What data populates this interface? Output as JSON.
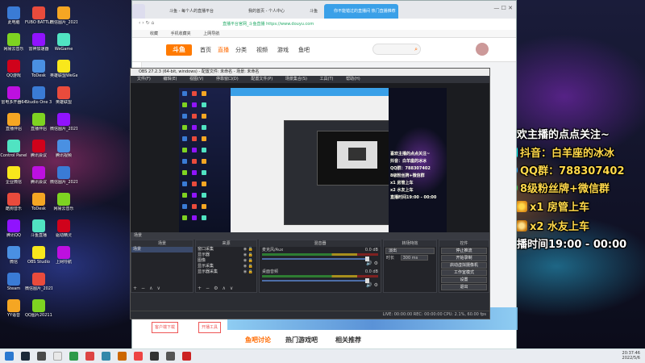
{
  "desktop_icons": [
    {
      "label": "此电脑",
      "x": 0,
      "y": 0
    },
    {
      "label": "FUBO BATTLEGR...",
      "x": 1,
      "y": 0
    },
    {
      "label": "微信图片_2021121...",
      "x": 2,
      "y": 0
    },
    {
      "label": "网易云音乐",
      "x": 0,
      "y": 1
    },
    {
      "label": "雷神加速器",
      "x": 1,
      "y": 1
    },
    {
      "label": "WeGame",
      "x": 2,
      "y": 1
    },
    {
      "label": "QQ游戏",
      "x": 0,
      "y": 2
    },
    {
      "label": "ToDesk",
      "x": 1,
      "y": 2
    },
    {
      "label": "英雄联盟WeGame版",
      "x": 2,
      "y": 2
    },
    {
      "label": "雷电多开器64",
      "x": 0,
      "y": 3
    },
    {
      "label": "Studio One 3",
      "x": 1,
      "y": 3
    },
    {
      "label": "英雄联盟",
      "x": 2,
      "y": 3
    },
    {
      "label": "直播伴侣",
      "x": 0,
      "y": 4
    },
    {
      "label": "直播伴侣",
      "x": 1,
      "y": 4
    },
    {
      "label": "微信图片_2021121...",
      "x": 2,
      "y": 4
    },
    {
      "label": "Control Panel",
      "x": 0,
      "y": 5
    },
    {
      "label": "腾讯会议",
      "x": 1,
      "y": 5
    },
    {
      "label": "腾讯视频",
      "x": 2,
      "y": 5
    },
    {
      "label": "企业微信",
      "x": 0,
      "y": 6
    },
    {
      "label": "腾讯会议",
      "x": 1,
      "y": 6
    },
    {
      "label": "微信图片_2021121...",
      "x": 2,
      "y": 6
    },
    {
      "label": "酷狗音乐",
      "x": 0,
      "y": 7
    },
    {
      "label": "ToDesk",
      "x": 1,
      "y": 7
    },
    {
      "label": "网易云音乐",
      "x": 2,
      "y": 7
    },
    {
      "label": "腾讯QQ",
      "x": 0,
      "y": 8
    },
    {
      "label": "斗鱼直播",
      "x": 1,
      "y": 8
    },
    {
      "label": "驱动精灵",
      "x": 2,
      "y": 8
    },
    {
      "label": "微信",
      "x": 0,
      "y": 9
    },
    {
      "label": "OBS Studio",
      "x": 1,
      "y": 9
    },
    {
      "label": "上网导航",
      "x": 2,
      "y": 9
    },
    {
      "label": "Steam",
      "x": 0,
      "y": 10
    },
    {
      "label": "微信图片_2021120...",
      "x": 1,
      "y": 10
    },
    {
      "label": "YY语音",
      "x": 0,
      "y": 11
    },
    {
      "label": "QQ图片2021120...",
      "x": 1,
      "y": 11
    }
  ],
  "promo": {
    "line1": "喜欢主播的点点关注~",
    "line2": "抖音：白羊座的冰冰",
    "line3": "QQ群：788307402",
    "line4": "8级粉丝牌+微信群",
    "line5": "x1 房管上车",
    "line6": "x2 水友上车",
    "line7": "直播时间19:00 - 00:00"
  },
  "browser": {
    "tabs": [
      "斗鱼 - 每个人的直播平台",
      "我的首页 - 个人中心",
      "斗鱼",
      "你不能错过的直播间 热门直播推荐"
    ],
    "address": "直播平台官网_斗鱼直播 https://www.douyu.com",
    "bookmarks": [
      "收藏",
      "手机收藏夹",
      "上网导航"
    ],
    "logo_text": "斗鱼",
    "nav": [
      "首页",
      "直播",
      "分类",
      "视频",
      "游戏",
      "鱼吧"
    ],
    "bottom_buttons": [
      "客户端下载",
      "开播工具"
    ],
    "bottom_tabs": [
      "鱼吧讨论",
      "热门游戏吧",
      "相关推荐"
    ]
  },
  "obs": {
    "title": "OBS 27.2.3 (64-bit, windows) - 配置文件: 未命名 - 场景: 未命名",
    "menu": [
      "文件(F)",
      "编辑(E)",
      "视图(V)",
      "停靠窗口(D)",
      "配置文件(P)",
      "场景集合(S)",
      "工具(T)",
      "帮助(H)"
    ],
    "dock_titles": [
      "场景",
      "来源",
      "混音器",
      "转场特效",
      "控件"
    ],
    "scenes": [
      "场景"
    ],
    "sources": [
      "窗口采集",
      "显示器",
      "图像",
      "显示采集",
      "显示器采集"
    ],
    "mixer": [
      {
        "name": "麦克风/Aux",
        "db": "0.0 dB"
      },
      {
        "name": "桌面音频",
        "db": "0.0 dB"
      }
    ],
    "transition": {
      "type": "淡出",
      "duration_label": "时长",
      "duration": "300 ms"
    },
    "controls": [
      "停止推流",
      "开始录制",
      "启动虚拟摄像机",
      "工作室模式",
      "设置",
      "退出"
    ],
    "status": "LIVE: 00:00:00   REC: 00:00:00   CPU: 2.1%, 60.00 fps"
  },
  "preview_text": [
    "喜欢主播的点点关注~",
    "抖音：白羊座的冰冰",
    "QQ群：788307402",
    "8级粉丝牌+微信群",
    "x1 房管上车",
    "x2 水友上车",
    "直播时间19:00 - 00:00"
  ],
  "taskbar": {
    "time": "20:37:46",
    "date": "2022/5/6"
  }
}
